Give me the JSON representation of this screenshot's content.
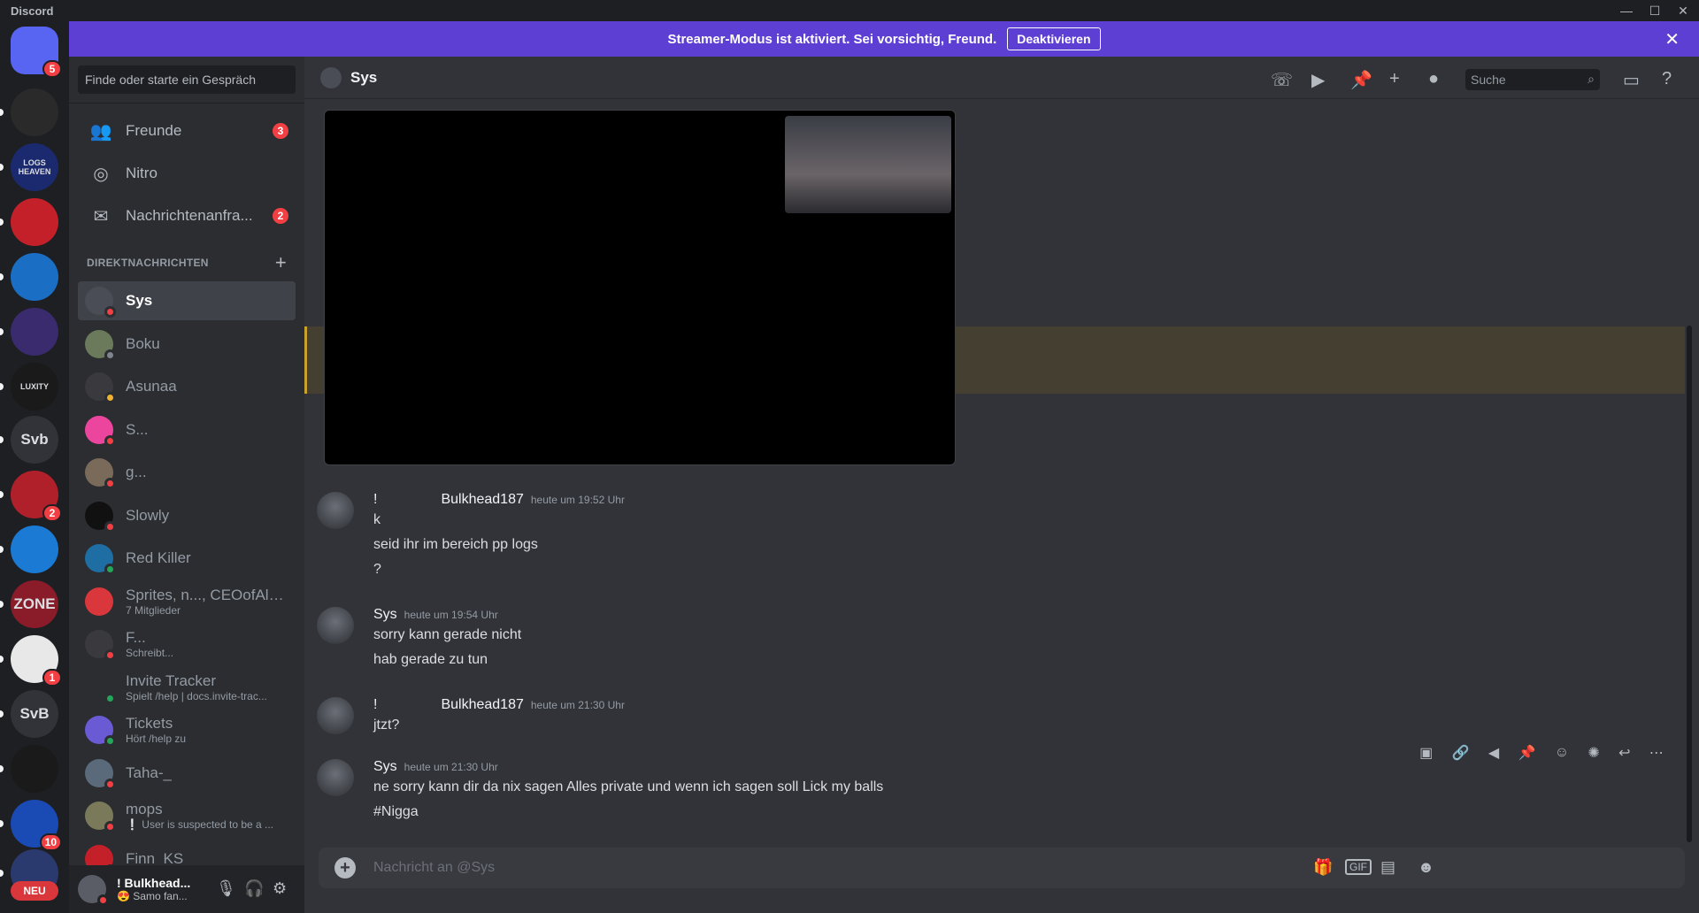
{
  "app": {
    "title": "Discord"
  },
  "window_controls": {
    "minimize": "—",
    "maximize": "☐",
    "close": "✕"
  },
  "rail": [
    {
      "label": "",
      "badge": "5",
      "color": "#5865f2",
      "icon": "discord-logo-icon"
    },
    {
      "label": "",
      "badge": "",
      "color": "#2a2a2a"
    },
    {
      "label": "LOGS HEAVEN",
      "badge": "",
      "color": "#1b2a6e"
    },
    {
      "label": "",
      "badge": "",
      "color": "#c4202a"
    },
    {
      "label": "",
      "badge": "",
      "color": "#1a6ec4"
    },
    {
      "label": "",
      "badge": "",
      "color": "#3a2a6e"
    },
    {
      "label": "LUXITY",
      "badge": "",
      "color": "#1a1a1a"
    },
    {
      "label": "Svb",
      "badge": "",
      "color": "#313338"
    },
    {
      "label": "",
      "badge": "2",
      "color": "#b0202a"
    },
    {
      "label": "",
      "badge": "",
      "color": "#1a7ad4"
    },
    {
      "label": "ZONE",
      "badge": "",
      "color": "#8a1c2a"
    },
    {
      "label": "",
      "badge": "1",
      "color": "#e8e8e8"
    },
    {
      "label": "SvB",
      "badge": "",
      "color": "#313338"
    },
    {
      "label": "",
      "badge": "",
      "color": "#1a1a1a"
    },
    {
      "label": "",
      "badge": "10",
      "color": "#1a4ab4"
    },
    {
      "label": "",
      "badge": "",
      "color": "#2a3a6e"
    }
  ],
  "rail_new_label": "NEU",
  "banner": {
    "text": "Streamer-Modus ist aktiviert. Sei vorsichtig, Freund.",
    "button": "Deaktivieren",
    "close": "✕"
  },
  "sidebar": {
    "search_placeholder": "Finde oder starte ein Gespräch",
    "nav": [
      {
        "label": "Freunde",
        "badge": "3",
        "icon": "friends-icon"
      },
      {
        "label": "Nitro",
        "badge": "",
        "icon": "nitro-icon"
      },
      {
        "label": "Nachrichtenanfra...",
        "badge": "2",
        "icon": "envelope-icon"
      }
    ],
    "dm_header": "DIREKTNACHRICHTEN",
    "dm_add": "+",
    "dms": [
      {
        "name": "Sys",
        "sub": "",
        "status": "dnd",
        "selected": true,
        "color": "#4a4d55"
      },
      {
        "name": "Boku",
        "sub": "",
        "status": "offline",
        "selected": false,
        "color": "#6a7a5a"
      },
      {
        "name": "Asunaa",
        "sub": "",
        "status": "idle",
        "selected": false,
        "color": "#3a3a3e"
      },
      {
        "name": "S...",
        "sub": "",
        "status": "dnd",
        "selected": false,
        "color": "#eb459e"
      },
      {
        "name": "g...",
        "sub": "",
        "status": "dnd",
        "selected": false,
        "color": "#7a6a5a"
      },
      {
        "name": "Slowly",
        "sub": "",
        "status": "dnd",
        "selected": false,
        "color": "#111111"
      },
      {
        "name": "Red Killer",
        "sub": "",
        "status": "online",
        "selected": false,
        "color": "#1e6ea4"
      },
      {
        "name": "Sprites, n..., CEOofAlt...",
        "sub": "7 Mitglieder",
        "status": "none",
        "selected": false,
        "color": "#da373c"
      },
      {
        "name": "F...",
        "sub": "Schreibt...",
        "status": "dnd",
        "selected": false,
        "color": "#3a3a3e"
      },
      {
        "name": "Invite Tracker",
        "sub": "Spielt /help | docs.invite-trac...",
        "status": "online",
        "selected": false,
        "color": "#2b2d31"
      },
      {
        "name": "Tickets",
        "sub": "Hört /help zu",
        "status": "online",
        "selected": false,
        "color": "#6a5ad4"
      },
      {
        "name": "Taha-_",
        "sub": "",
        "status": "dnd",
        "selected": false,
        "color": "#5a6a7a"
      },
      {
        "name": "mops",
        "sub": "❕ User is suspected to be a ...",
        "status": "dnd",
        "selected": false,
        "color": "#7a7a5a"
      },
      {
        "name": "Finn_KS",
        "sub": "",
        "status": "dnd",
        "selected": false,
        "color": "#c4202a"
      }
    ],
    "user": {
      "name": "! Bulkhead...",
      "status": "😍 Samo fan..."
    }
  },
  "chat": {
    "title": "Sys",
    "search_placeholder": "Suche",
    "messages": [
      {
        "author_prefix": "!",
        "author": "Bulkhead187",
        "time": "heute um 19:52 Uhr",
        "lines": [
          "k",
          "seid ihr im bereich pp logs",
          "?"
        ]
      },
      {
        "author_prefix": "",
        "author": "Sys",
        "time": "heute um 19:54 Uhr",
        "lines": [
          "sorry kann gerade nicht",
          "hab gerade zu tun"
        ]
      },
      {
        "author_prefix": "!",
        "author": "Bulkhead187",
        "time": "heute um 21:30 Uhr",
        "lines": [
          "jtzt?"
        ]
      },
      {
        "author_prefix": "",
        "author": "Sys",
        "time": "heute um 21:30 Uhr",
        "lines": [
          "ne sorry kann dir da nix sagen Alles private und wenn ich sagen soll Lick my balls",
          "#Nigga"
        ]
      }
    ],
    "composer_placeholder": "Nachricht an @Sys",
    "composer_gif": "GIF"
  }
}
